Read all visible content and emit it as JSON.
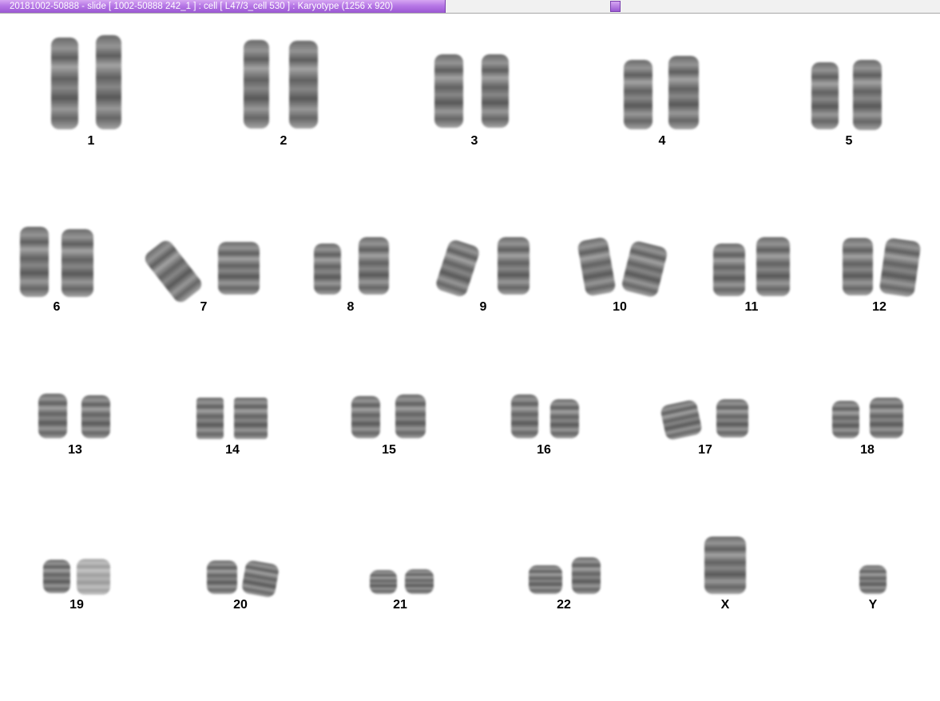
{
  "window": {
    "title": "20181002-50888 - slide [ 1002-50888 242_1 ] : cell [ L47/3_cell 530 ] : Karyotype  (1256 x 920)"
  },
  "karyotype": {
    "labels": {
      "c1": "1",
      "c2": "2",
      "c3": "3",
      "c4": "4",
      "c5": "5",
      "c6": "6",
      "c7": "7",
      "c8": "8",
      "c9": "9",
      "c10": "10",
      "c11": "11",
      "c12": "12",
      "c13": "13",
      "c14": "14",
      "c15": "15",
      "c16": "16",
      "c17": "17",
      "c18": "18",
      "c19": "19",
      "c20": "20",
      "c21": "21",
      "c22": "22",
      "cX": "X",
      "cY": "Y"
    }
  }
}
